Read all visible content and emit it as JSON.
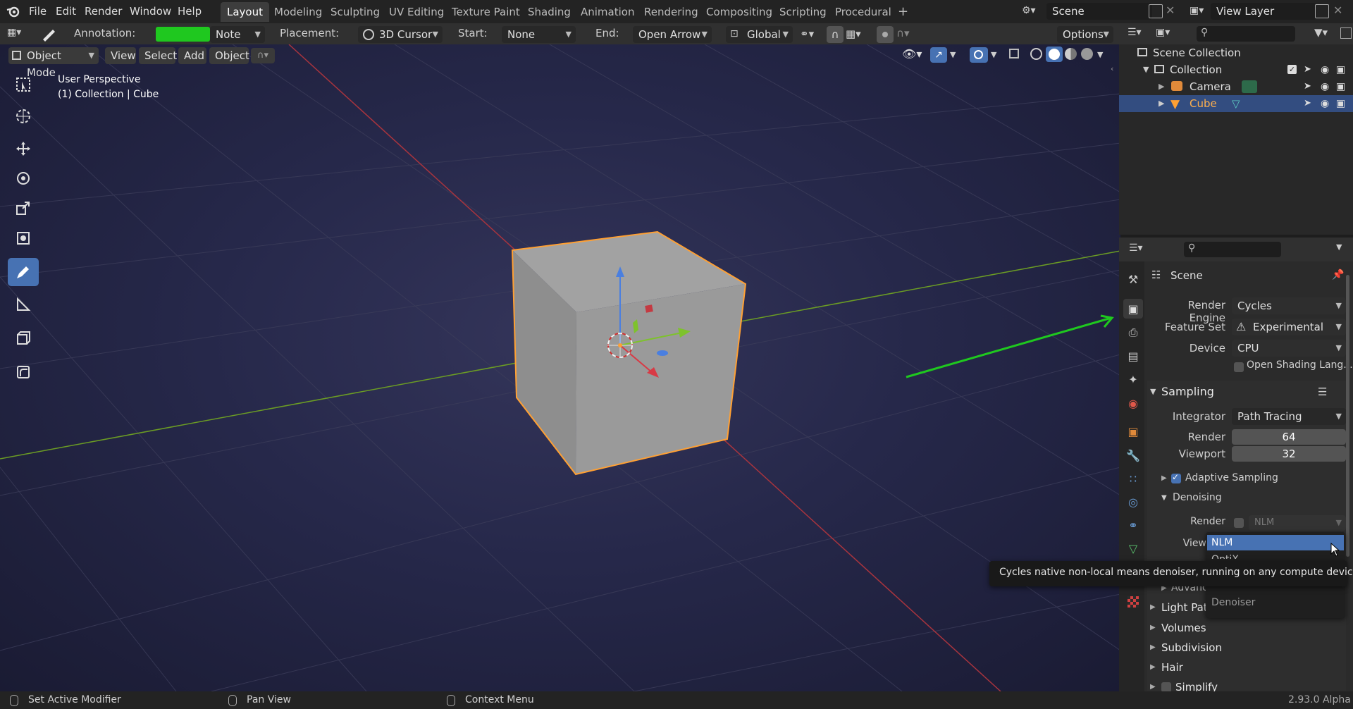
{
  "menu": {
    "items": [
      "File",
      "Edit",
      "Render",
      "Window",
      "Help"
    ]
  },
  "workspaces": {
    "tabs": [
      "Layout",
      "Modeling",
      "Sculpting",
      "UV Editing",
      "Texture Paint",
      "Shading",
      "Animation",
      "Rendering",
      "Compositing",
      "Scripting",
      "Procedural"
    ],
    "active": "Layout",
    "add_label": "+"
  },
  "scene": {
    "name": "Scene",
    "view_layer": "View Layer"
  },
  "tool_header": {
    "annotation_label": "Annotation:",
    "annotation_color": "#1fc81f",
    "note_value": "Note",
    "placement_label": "Placement:",
    "placement_value": "3D Cursor",
    "start_label": "Start:",
    "start_value": "None",
    "end_label": "End:",
    "end_value": "Open Arrow",
    "orientation_value": "Global",
    "options_label": "Options"
  },
  "viewport_header": {
    "mode": "Object Mode",
    "menus": [
      "View",
      "Select",
      "Add",
      "Object"
    ]
  },
  "viewport": {
    "view_name": "User Perspective",
    "collection_info": "(1) Collection | Cube"
  },
  "outliner": {
    "root": "Scene Collection",
    "collection": "Collection",
    "items": [
      {
        "name": "Camera",
        "icon": "camera-icon"
      },
      {
        "name": "Cube",
        "icon": "mesh-icon"
      }
    ]
  },
  "properties": {
    "context": "Scene",
    "render_engine_label": "Render Engine",
    "render_engine": "Cycles",
    "feature_set_label": "Feature Set",
    "feature_set": "Experimental",
    "device_label": "Device",
    "device": "CPU",
    "osl_label": "Open Shading Lang...",
    "sampling": {
      "title": "Sampling",
      "integrator_label": "Integrator",
      "integrator": "Path Tracing",
      "render_label": "Render",
      "render_samples": "64",
      "viewport_label": "Viewport",
      "viewport_samples": "32",
      "adaptive_label": "Adaptive Sampling",
      "denoising_title": "Denoising",
      "denoise_render_label": "Render",
      "denoise_render_value": "NLM",
      "denoise_view_label": "View"
    },
    "collapsed_panels": [
      "Light Paths",
      "Volumes",
      "Subdivision",
      "Hair",
      "Simplify"
    ],
    "advanced_partial": "Advanc"
  },
  "dropdown": {
    "items": [
      "NLM",
      "OptiX"
    ],
    "selected": "NLM",
    "footer": "Denoiser"
  },
  "tooltip": {
    "text": "Cycles native non-local means denoiser, running on any compute device."
  },
  "status_bar": {
    "items": [
      "Set Active Modifier",
      "Pan View",
      "Context Menu"
    ],
    "version": "2.93.0 Alpha"
  },
  "colors": {
    "accent": "#4772b3",
    "selection_orange": "#ffa033",
    "axis_x": "#a8343e",
    "axis_y": "#6b9c24",
    "annotation": "#1fc81f"
  }
}
